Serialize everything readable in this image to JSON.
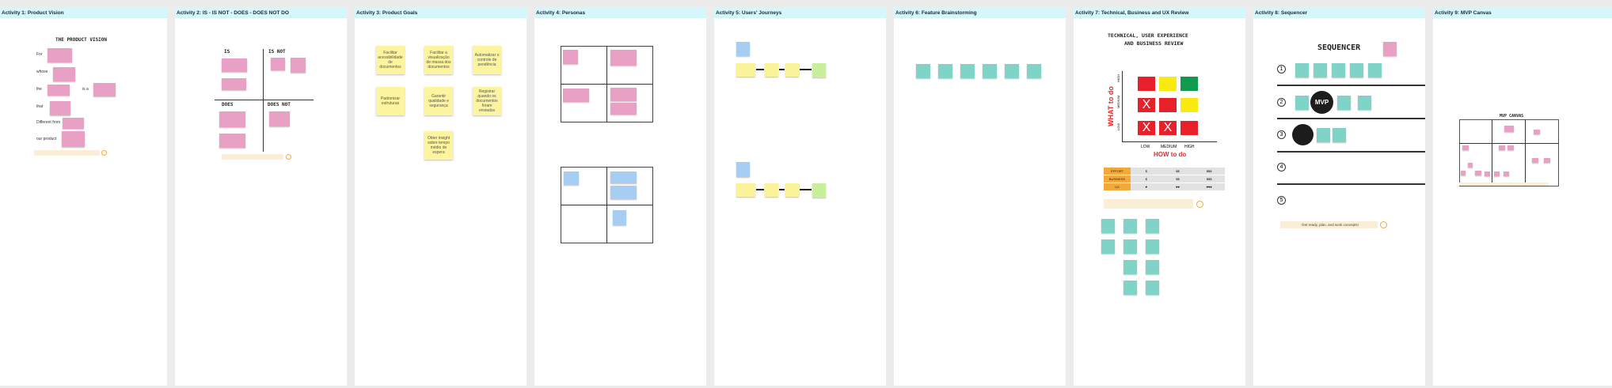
{
  "frames": [
    {
      "title": "Activity 1: Product Vision"
    },
    {
      "title": "Activity 2:  IS - IS NOT - DOES - DOES NOT DO"
    },
    {
      "title": "Activity 3: Product Goals"
    },
    {
      "title": "Activity 4: Personas"
    },
    {
      "title": "Activity 5: Users' Journeys"
    },
    {
      "title": "Activity 6:  Feature Brainstorming"
    },
    {
      "title": "Activity 7: Technical, Business and UX Review"
    },
    {
      "title": "Activity 8: Sequencer"
    },
    {
      "title": "Activity 9: MVP Canvas"
    }
  ],
  "vision": {
    "heading": "THE PRODUCT VISION",
    "labels": [
      "For",
      "whose",
      "the",
      "that",
      "Different from",
      "our product"
    ],
    "is_label": "is a"
  },
  "isnot": {
    "is": "IS",
    "isnot": "IS NOT",
    "does": "DOES",
    "doesnot": "DOES NOT"
  },
  "goals": {
    "notes": [
      "Facilitar acessibilidade de documentos",
      "Facilitar a visualização de massa dos documentos",
      "Automatizar o controle de pendência",
      "Padronizar estruturas",
      "Garantir qualidade e segurança",
      "Registrar quando os documentos foram enviados",
      "Obter insight sobre tempo médio de espera"
    ]
  },
  "review": {
    "heading_line1": "TECHNICAL, USER EXPERIENCE",
    "heading_line2": "AND BUSINESS REVIEW",
    "what": "WHAT to do",
    "how": "HOW to do",
    "y_levels": [
      "HIGH",
      "MEDIUM",
      "LOW"
    ],
    "x_levels": [
      "LOW",
      "MEDIUM",
      "HIGH"
    ],
    "legend_rows": [
      "EFFORT",
      "BUSINESS",
      "UX"
    ],
    "legend_marks": [
      [
        "$",
        "$$",
        "$$$"
      ],
      [
        "$",
        "$$",
        "$$$"
      ],
      [
        "♥",
        "♥♥",
        "♥♥♥"
      ]
    ]
  },
  "sequencer": {
    "heading": "SEQUENCER",
    "rows": [
      "1",
      "2",
      "3",
      "4",
      "5"
    ],
    "mvp": "MVP",
    "footer": "Get ready, plan, and work concepts!"
  },
  "mvp": {
    "heading": "MVP CANVAS"
  },
  "colors": {
    "header_bg": "#d5f6fa",
    "pink_note": "#e8a0c4",
    "yellow_note": "#fbf39a",
    "teal_note": "#7fd3c7",
    "blue_note": "#a8cdf2",
    "green_note": "#c9ee9c"
  }
}
